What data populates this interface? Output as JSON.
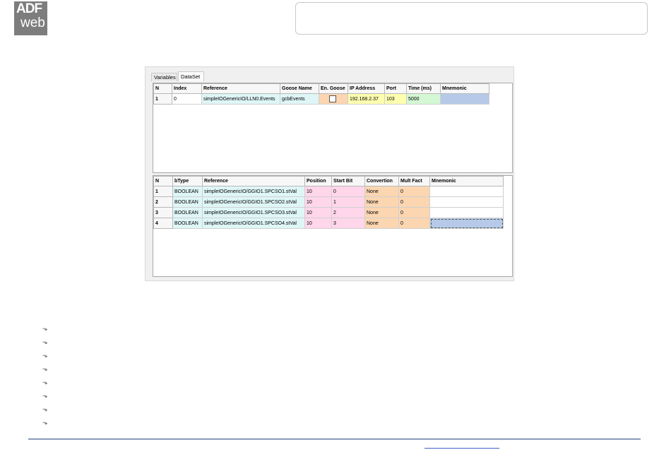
{
  "logo": {
    "line1": "ADF",
    "line2": "web"
  },
  "tabs": [
    "Variables",
    "DataSet"
  ],
  "dataset": {
    "columns": [
      "N",
      "Index",
      "Reference",
      "Goose Name",
      "En. Goose",
      "IP Address",
      "Port",
      "Time (ms)",
      "Mnemonic"
    ],
    "rows": [
      {
        "n": "1",
        "index": "0",
        "reference": "simpleIOGenericIO/LLN0.Events",
        "goose_name": "gcbEvents",
        "en_goose": false,
        "ip": "192.168.2.37",
        "port": "103",
        "time": "5000",
        "mnemonic": ""
      }
    ]
  },
  "variables": {
    "columns": [
      "N",
      "bType",
      "Reference",
      "Position",
      "Start Bit",
      "Convertion",
      "Mult Fact",
      "Mnemonic"
    ],
    "rows": [
      {
        "n": "1",
        "btype": "BOOLEAN",
        "reference": "simpleIOGenericIO/GGIO1.SPCSO1.stVal",
        "position": "10",
        "start_bit": "0",
        "convertion": "None",
        "mult_fact": "0",
        "mnemonic": ""
      },
      {
        "n": "2",
        "btype": "BOOLEAN",
        "reference": "simpleIOGenericIO/GGIO1.SPCSO2.stVal",
        "position": "10",
        "start_bit": "1",
        "convertion": "None",
        "mult_fact": "0",
        "mnemonic": ""
      },
      {
        "n": "3",
        "btype": "BOOLEAN",
        "reference": "simpleIOGenericIO/GGIO1.SPCSO3.stVal",
        "position": "10",
        "start_bit": "2",
        "convertion": "None",
        "mult_fact": "0",
        "mnemonic": ""
      },
      {
        "n": "4",
        "btype": "BOOLEAN",
        "reference": "simpleIOGenericIO/GGIO1.SPCSO4.stVal",
        "position": "10",
        "start_bit": "3",
        "convertion": "None",
        "mult_fact": "0",
        "mnemonic": ""
      }
    ]
  },
  "bullets": {
    "count": 8,
    "icon": "arrow-bullet-icon"
  },
  "colors": {
    "cyan": "#dff6f6",
    "peach": "#fbd6b1",
    "yellow": "#ffffb0",
    "green": "#d4f7d4",
    "blue": "#b6c9e8",
    "pink": "#ffd6ea",
    "footer_line": "#1f3f7a",
    "link": "#3d62c9"
  }
}
